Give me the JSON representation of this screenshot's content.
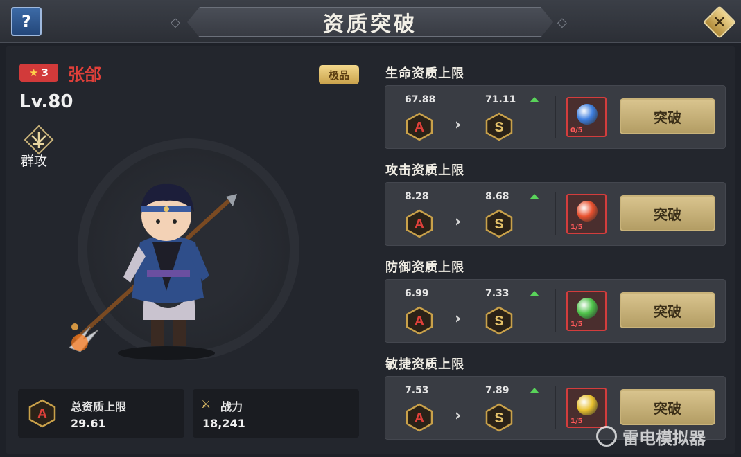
{
  "header": {
    "help_label": "?",
    "title": "资质突破",
    "close_label": "✕"
  },
  "hero": {
    "stars": "3",
    "name": "张郃",
    "grade": "极品",
    "level": "Lv.80",
    "skill": "群攻"
  },
  "summary": {
    "total_label": "总资质上限",
    "total_value": "29.61",
    "total_rank": "A",
    "power_label": "战力",
    "power_value": "18,241"
  },
  "stats": [
    {
      "title": "生命资质上限",
      "current": "67.88",
      "next": "71.11",
      "current_rank": "A",
      "next_rank": "S",
      "item_count": "0/5",
      "orb_color": "#3f7fe0",
      "button": "突破"
    },
    {
      "title": "攻击资质上限",
      "current": "8.28",
      "next": "8.68",
      "current_rank": "A",
      "next_rank": "S",
      "item_count": "1/5",
      "orb_color": "#e8502e",
      "button": "突破"
    },
    {
      "title": "防御资质上限",
      "current": "6.99",
      "next": "7.33",
      "current_rank": "A",
      "next_rank": "S",
      "item_count": "1/5",
      "orb_color": "#4fc24a",
      "button": "突破"
    },
    {
      "title": "敏捷资质上限",
      "current": "7.53",
      "next": "7.89",
      "current_rank": "A",
      "next_rank": "S",
      "item_count": "1/5",
      "orb_color": "#e8c02e",
      "button": "突破"
    }
  ],
  "watermark": "雷电模拟器",
  "colors": {
    "rank_a": "#e0403a",
    "rank_s": "#e6c36a",
    "accent_gold": "#d9c48e",
    "arrow_up": "#59d35a"
  }
}
